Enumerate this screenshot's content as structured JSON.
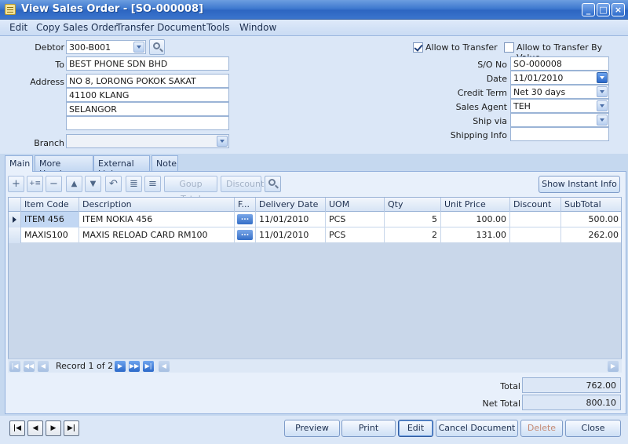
{
  "window": {
    "title": "View Sales Order - [SO-000008]"
  },
  "menu": [
    "Edit",
    "Copy Sales Order",
    "Transfer Document",
    "Tools",
    "Window"
  ],
  "header": {
    "debtor_label": "Debtor",
    "debtor": "300-B001",
    "to_label": "To",
    "to": "BEST PHONE SDN BHD",
    "address_label": "Address",
    "address": [
      "NO 8, LORONG POKOK SAKAT",
      "41100 KLANG",
      "SELANGOR",
      ""
    ],
    "branch_label": "Branch",
    "branch": "",
    "allow_transfer": "Allow to Transfer",
    "allow_transfer_by_value": "Allow to Transfer By Value",
    "so_no_label": "S/O  No",
    "so_no": "SO-000008",
    "date_label": "Date",
    "date": "11/01/2010",
    "credit_term_label": "Credit Term",
    "credit_term": "Net 30 days",
    "sales_agent_label": "Sales Agent",
    "sales_agent": "TEH",
    "ship_via_label": "Ship via",
    "ship_via": "",
    "shipping_info_label": "Shipping Info",
    "shipping_info": ""
  },
  "tabs": [
    "Main",
    "More Header",
    "External Link",
    "Note"
  ],
  "toolbar": {
    "add_icon": "+",
    "insert_icon": "+≡",
    "delete_icon": "−",
    "move_up_icon": "▲",
    "move_down_icon": "▼",
    "undo_icon": "↶",
    "list1_icon": "≣",
    "list2_icon": "≡",
    "group_total": "Goup Total",
    "discount": "Discount",
    "show_instant_info": "Show Instant Info"
  },
  "grid": {
    "columns": [
      "Item Code",
      "Description",
      "F...",
      "Delivery Date",
      "UOM",
      "Qty",
      "Unit Price",
      "Discount",
      "SubTotal"
    ],
    "rows": [
      {
        "item_code": "ITEM 456",
        "description": "ITEM NOKIA 456",
        "f": "...",
        "delivery_date": "11/01/2010",
        "uom": "PCS",
        "qty": "5",
        "unit_price": "100.00",
        "discount": "",
        "subtotal": "500.00"
      },
      {
        "item_code": "MAXIS100",
        "description": "MAXIS RELOAD CARD RM100",
        "f": "...",
        "delivery_date": "11/01/2010",
        "uom": "PCS",
        "qty": "2",
        "unit_price": "131.00",
        "discount": "",
        "subtotal": "262.00"
      }
    ],
    "record_text": "Record 1 of 2"
  },
  "totals": {
    "total_label": "Total",
    "total": "762.00",
    "net_total_label": "Net Total",
    "net_total": "800.10"
  },
  "buttons": {
    "preview": "Preview",
    "print": "Print",
    "edit": "Edit",
    "cancel_document": "Cancel Document",
    "delete": "Delete",
    "close": "Close"
  }
}
